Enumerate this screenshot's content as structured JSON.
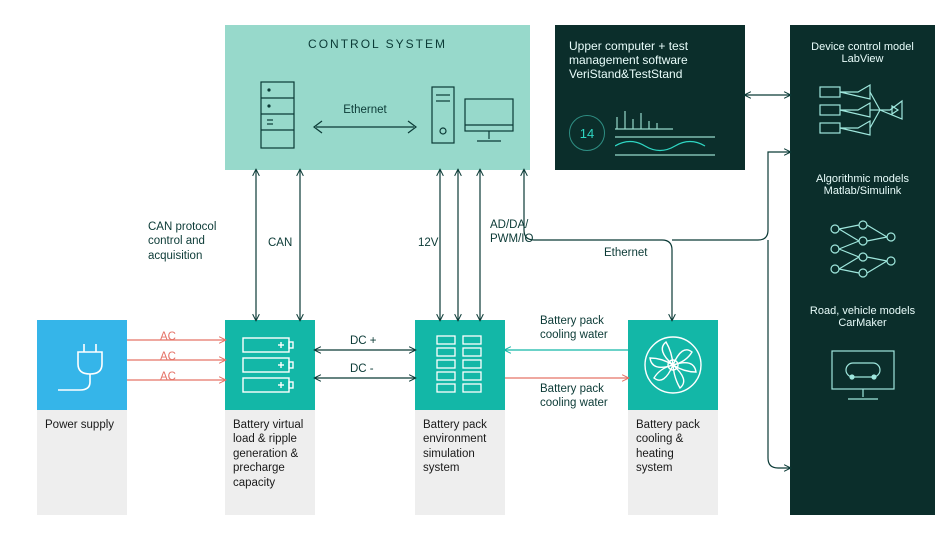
{
  "control_system": {
    "title": "CONTROL SYSTEM",
    "link": "Ethernet"
  },
  "upper": {
    "line1": "Upper computer + test",
    "line2": "management software",
    "line3": "VeriStand&TestStand",
    "badge": "14"
  },
  "right_panel": {
    "title1": "Device control model",
    "title2": "LabView",
    "alg1": "Algorithmic models",
    "alg2": "Matlab/Simulink",
    "road1": "Road, vehicle models",
    "road2": "CarMaker"
  },
  "power_supply": {
    "label": "Power supply"
  },
  "battery_load": {
    "label_l1": "Battery virtual",
    "label_l2": "load & ripple",
    "label_l3": "generation &",
    "label_l4": "precharge",
    "label_l5": "capacity"
  },
  "env_sim": {
    "label_l1": "Battery pack",
    "label_l2": "environment",
    "label_l3": "simulation",
    "label_l4": "system"
  },
  "cooling": {
    "label_l1": "Battery pack",
    "label_l2": "cooling &",
    "label_l3": "heating",
    "label_l4": "system"
  },
  "links": {
    "can_acq_l1": "CAN protocol",
    "can_acq_l2": "control and",
    "can_acq_l3": "acquisition",
    "can": "CAN",
    "v12": "12V",
    "addapwmio_l1": "AD/DA/",
    "addapwmio_l2": "PWM/IO",
    "eth": "Ethernet",
    "ac": "AC",
    "dcp": "DC +",
    "dcm": "DC -",
    "cool_top_l1": "Battery pack",
    "cool_top_l2": "cooling water",
    "cool_bot_l1": "Battery pack",
    "cool_bot_l2": "cooling water"
  },
  "colors": {
    "teal": "#13b7a7",
    "dark": "#0b2e2b",
    "mint": "#97d9cb",
    "blue": "#35b5e9",
    "grey": "#eeeeee",
    "teal_stroke": "#0d8f84",
    "red": "#e57368"
  }
}
